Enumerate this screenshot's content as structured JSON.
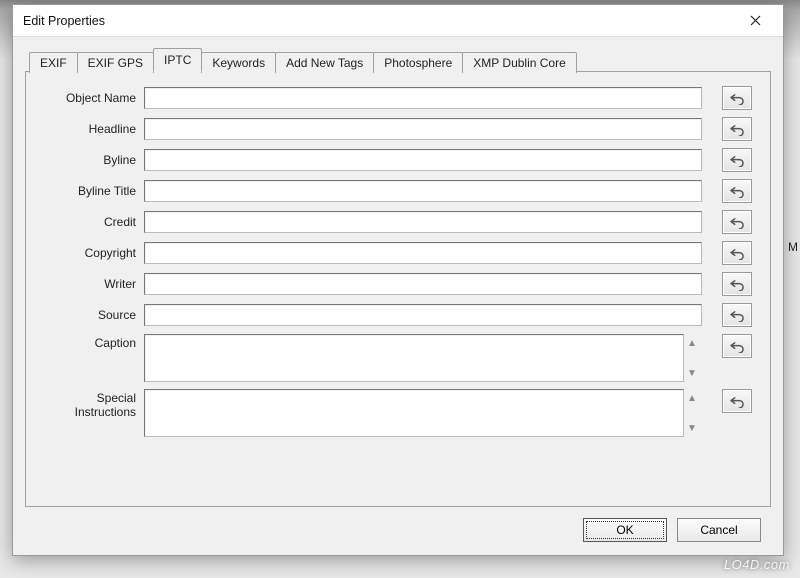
{
  "window": {
    "title": "Edit Properties"
  },
  "tabs": [
    {
      "label": "EXIF"
    },
    {
      "label": "EXIF GPS"
    },
    {
      "label": "IPTC"
    },
    {
      "label": "Keywords"
    },
    {
      "label": "Add New Tags"
    },
    {
      "label": "Photosphere"
    },
    {
      "label": "XMP Dublin Core"
    }
  ],
  "activeTab": "IPTC",
  "fields": {
    "object_name": {
      "label": "Object Name",
      "value": ""
    },
    "headline": {
      "label": "Headline",
      "value": ""
    },
    "byline": {
      "label": "Byline",
      "value": ""
    },
    "byline_title": {
      "label": "Byline Title",
      "value": ""
    },
    "credit": {
      "label": "Credit",
      "value": ""
    },
    "copyright": {
      "label": "Copyright",
      "value": ""
    },
    "writer": {
      "label": "Writer",
      "value": ""
    },
    "source": {
      "label": "Source",
      "value": ""
    },
    "caption": {
      "label": "Caption",
      "value": ""
    },
    "special": {
      "label": "Special Instructions",
      "value": ""
    }
  },
  "buttons": {
    "ok": "OK",
    "cancel": "Cancel"
  },
  "watermark": "LO4D.com",
  "stray": "M"
}
